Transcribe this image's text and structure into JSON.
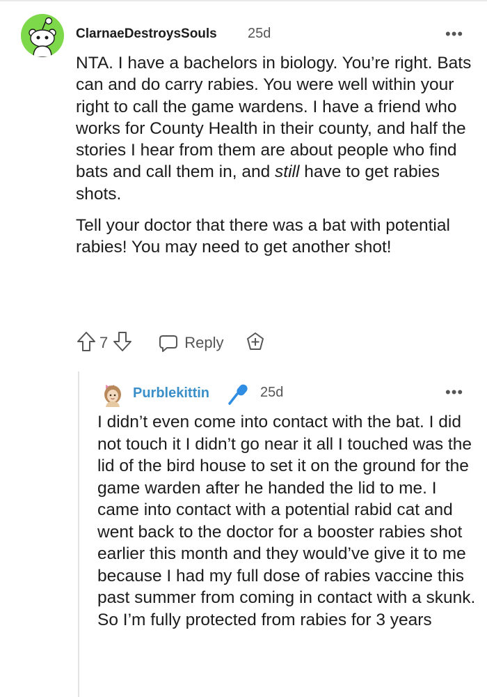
{
  "comment": {
    "username": "ClarnaeDestroysSouls",
    "timestamp": "25d",
    "more_label": "•••",
    "paragraph1_a": "NTA. I have a bachelors in biology. You’re right. Bats can and do carry rabies. You were well within your right to call the game wardens. I have a friend who works for County Health in their county, and half the stories I hear from them are about people who find bats and call them in, and ",
    "paragraph1_em": "still",
    "paragraph1_b": " have to get rabies shots.",
    "paragraph2": "Tell your doctor that there was a bat with potential rabies! You may need to get another shot!",
    "vote_count": "7",
    "reply_label": "Reply",
    "avatar_color": "#7dd84a"
  },
  "reply": {
    "username": "Purblekittin",
    "timestamp": "25d",
    "more_label": "•••",
    "text": "I didn’t even come into contact with the bat. I did not touch it I didn’t go near it all I touched was the lid of the bird house to set it on the ground for the game warden after he handed the lid to me. I came into contact with a potential rabid cat and went back to the doctor for a booster rabies shot earlier this month and they would’ve give it to me because I had my full dose of rabies vaccine this past summer from coming in contact with a skunk. So I’m fully protected from rabies for 3 years",
    "username_color": "#3a8fc9"
  }
}
